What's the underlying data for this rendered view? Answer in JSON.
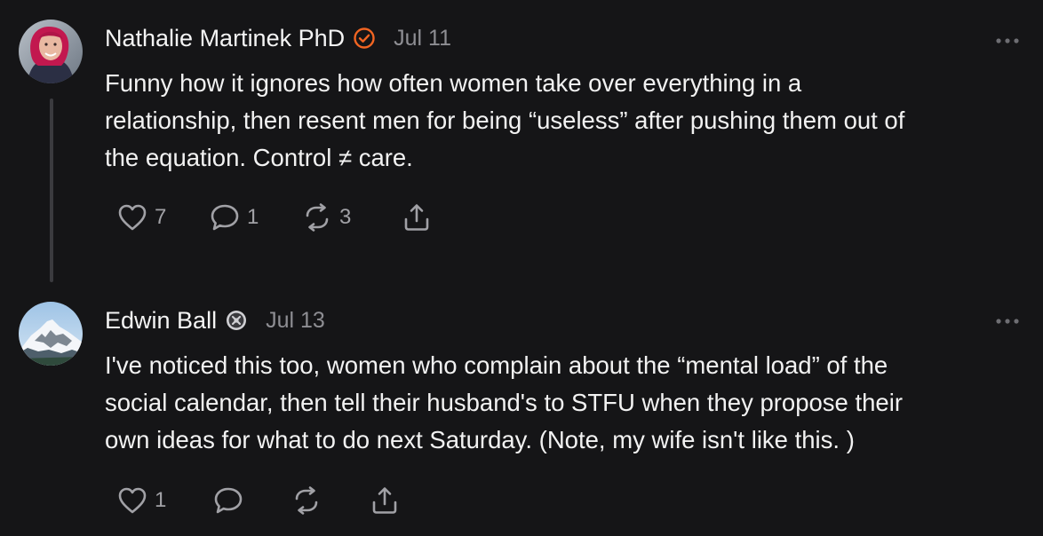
{
  "comments": [
    {
      "author": "Nathalie Martinek PhD",
      "date": "Jul 11",
      "body_lines": [
        "Funny how it ignores how often women take over everything in a",
        "relationship, then resent men for being “useless” after pushing them out of",
        "the equation. Control ≠ care."
      ],
      "badge": "verified-check-icon",
      "badge_color": "#f26522",
      "likes": "7",
      "comments": "1",
      "restacks": "3"
    },
    {
      "author": "Edwin Ball",
      "date": "Jul 13",
      "body_lines": [
        "I've noticed this too, women who complain about the “mental load” of the",
        "social calendar, then tell their husband's to STFU when they propose their",
        "own ideas for what to do next Saturday. (Note, my wife isn't like this. )"
      ],
      "badge": "founding-member-icon",
      "likes": "1",
      "comments": "",
      "restacks": ""
    }
  ],
  "icons": {
    "like": "heart-icon",
    "comment": "comment-bubble-icon",
    "restack": "restack-icon",
    "share": "share-icon",
    "more": "more-dots-icon"
  },
  "colors": {
    "background": "#151517",
    "text": "#f2f2f2",
    "muted": "#8e8e93",
    "accent": "#f26522"
  }
}
